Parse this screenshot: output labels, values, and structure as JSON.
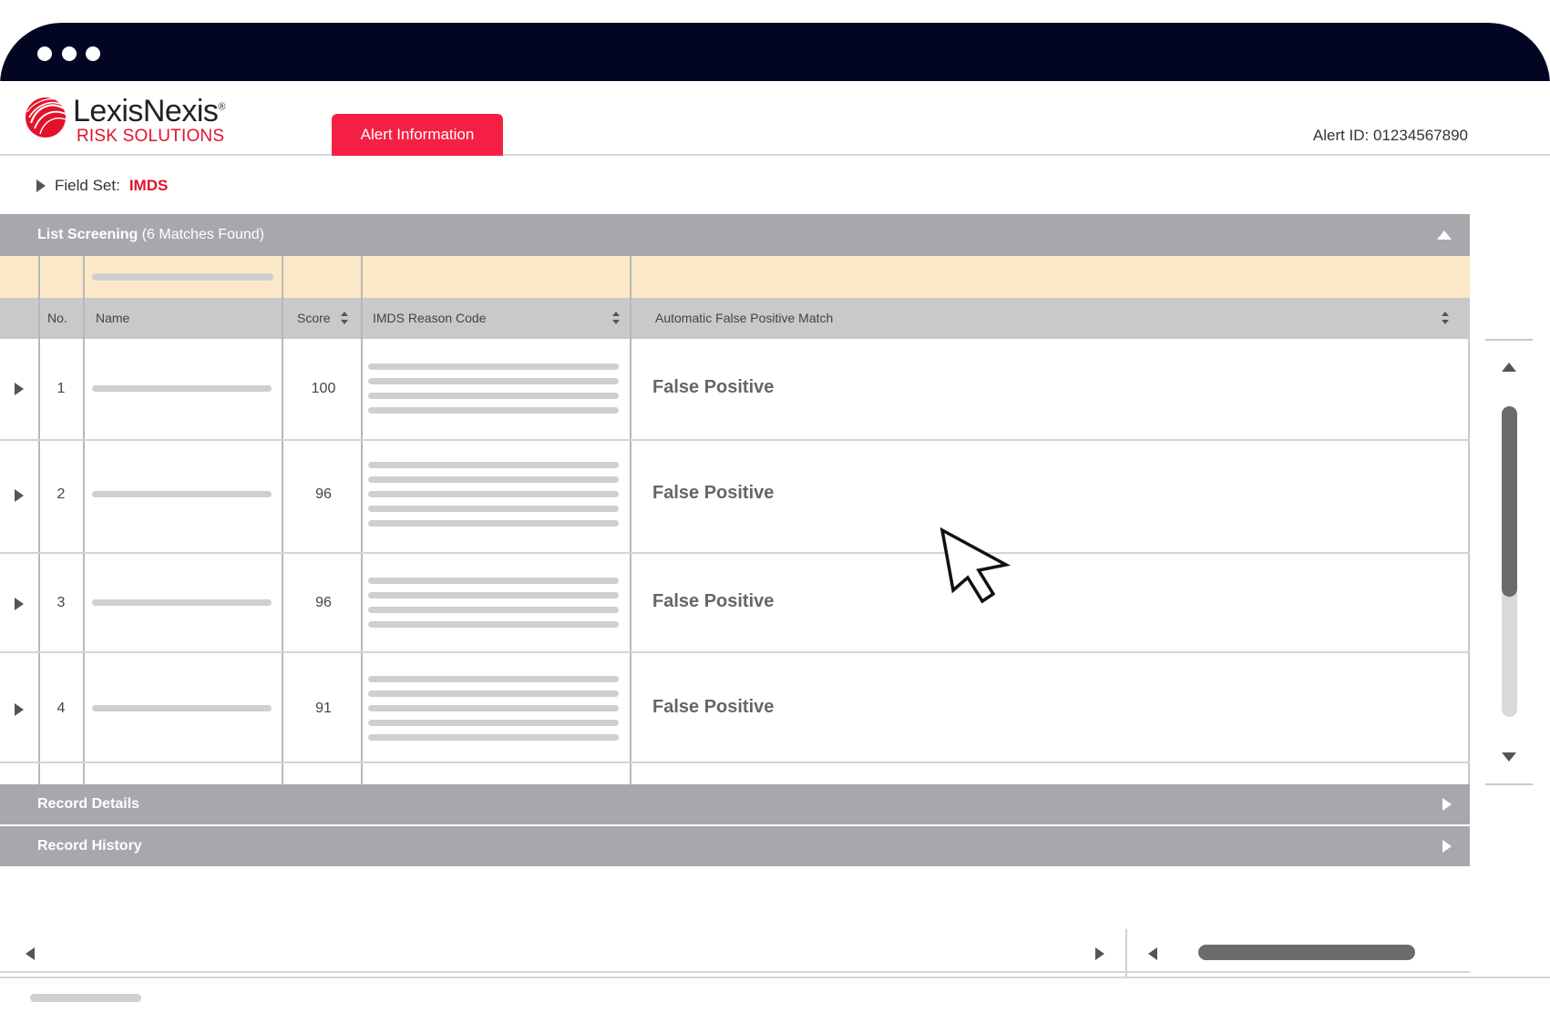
{
  "brand": {
    "name": "LexisNexis",
    "registered": "®",
    "subtitle": "RISK SOLUTIONS",
    "accent_color": "#e3122b"
  },
  "header": {
    "active_tab": "Alert Information",
    "alert_id": "Alert ID: 01234567890"
  },
  "field_set": {
    "label": "Field Set:",
    "value": "IMDS"
  },
  "list_screening": {
    "title": "List Screening",
    "matches": "(6 Matches Found)",
    "columns": {
      "no": "No.",
      "name": "Name",
      "score": "Score",
      "reason": "IMDS Reason Code",
      "match": "Automatic False Positive Match"
    },
    "rows": [
      {
        "no": "1",
        "score": "100",
        "match": "False Positive"
      },
      {
        "no": "2",
        "score": "96",
        "match": "False Positive"
      },
      {
        "no": "3",
        "score": "96",
        "match": "False Positive"
      },
      {
        "no": "4",
        "score": "91",
        "match": "False Positive"
      }
    ]
  },
  "sections": {
    "record_details": "Record Details",
    "record_history": "Record History"
  },
  "colors": {
    "titlebar": "#020622",
    "tab": "#f51f43",
    "panel": "#a7a8ac",
    "filter_row": "#fae8c9",
    "header_row": "#c9c9c9"
  }
}
